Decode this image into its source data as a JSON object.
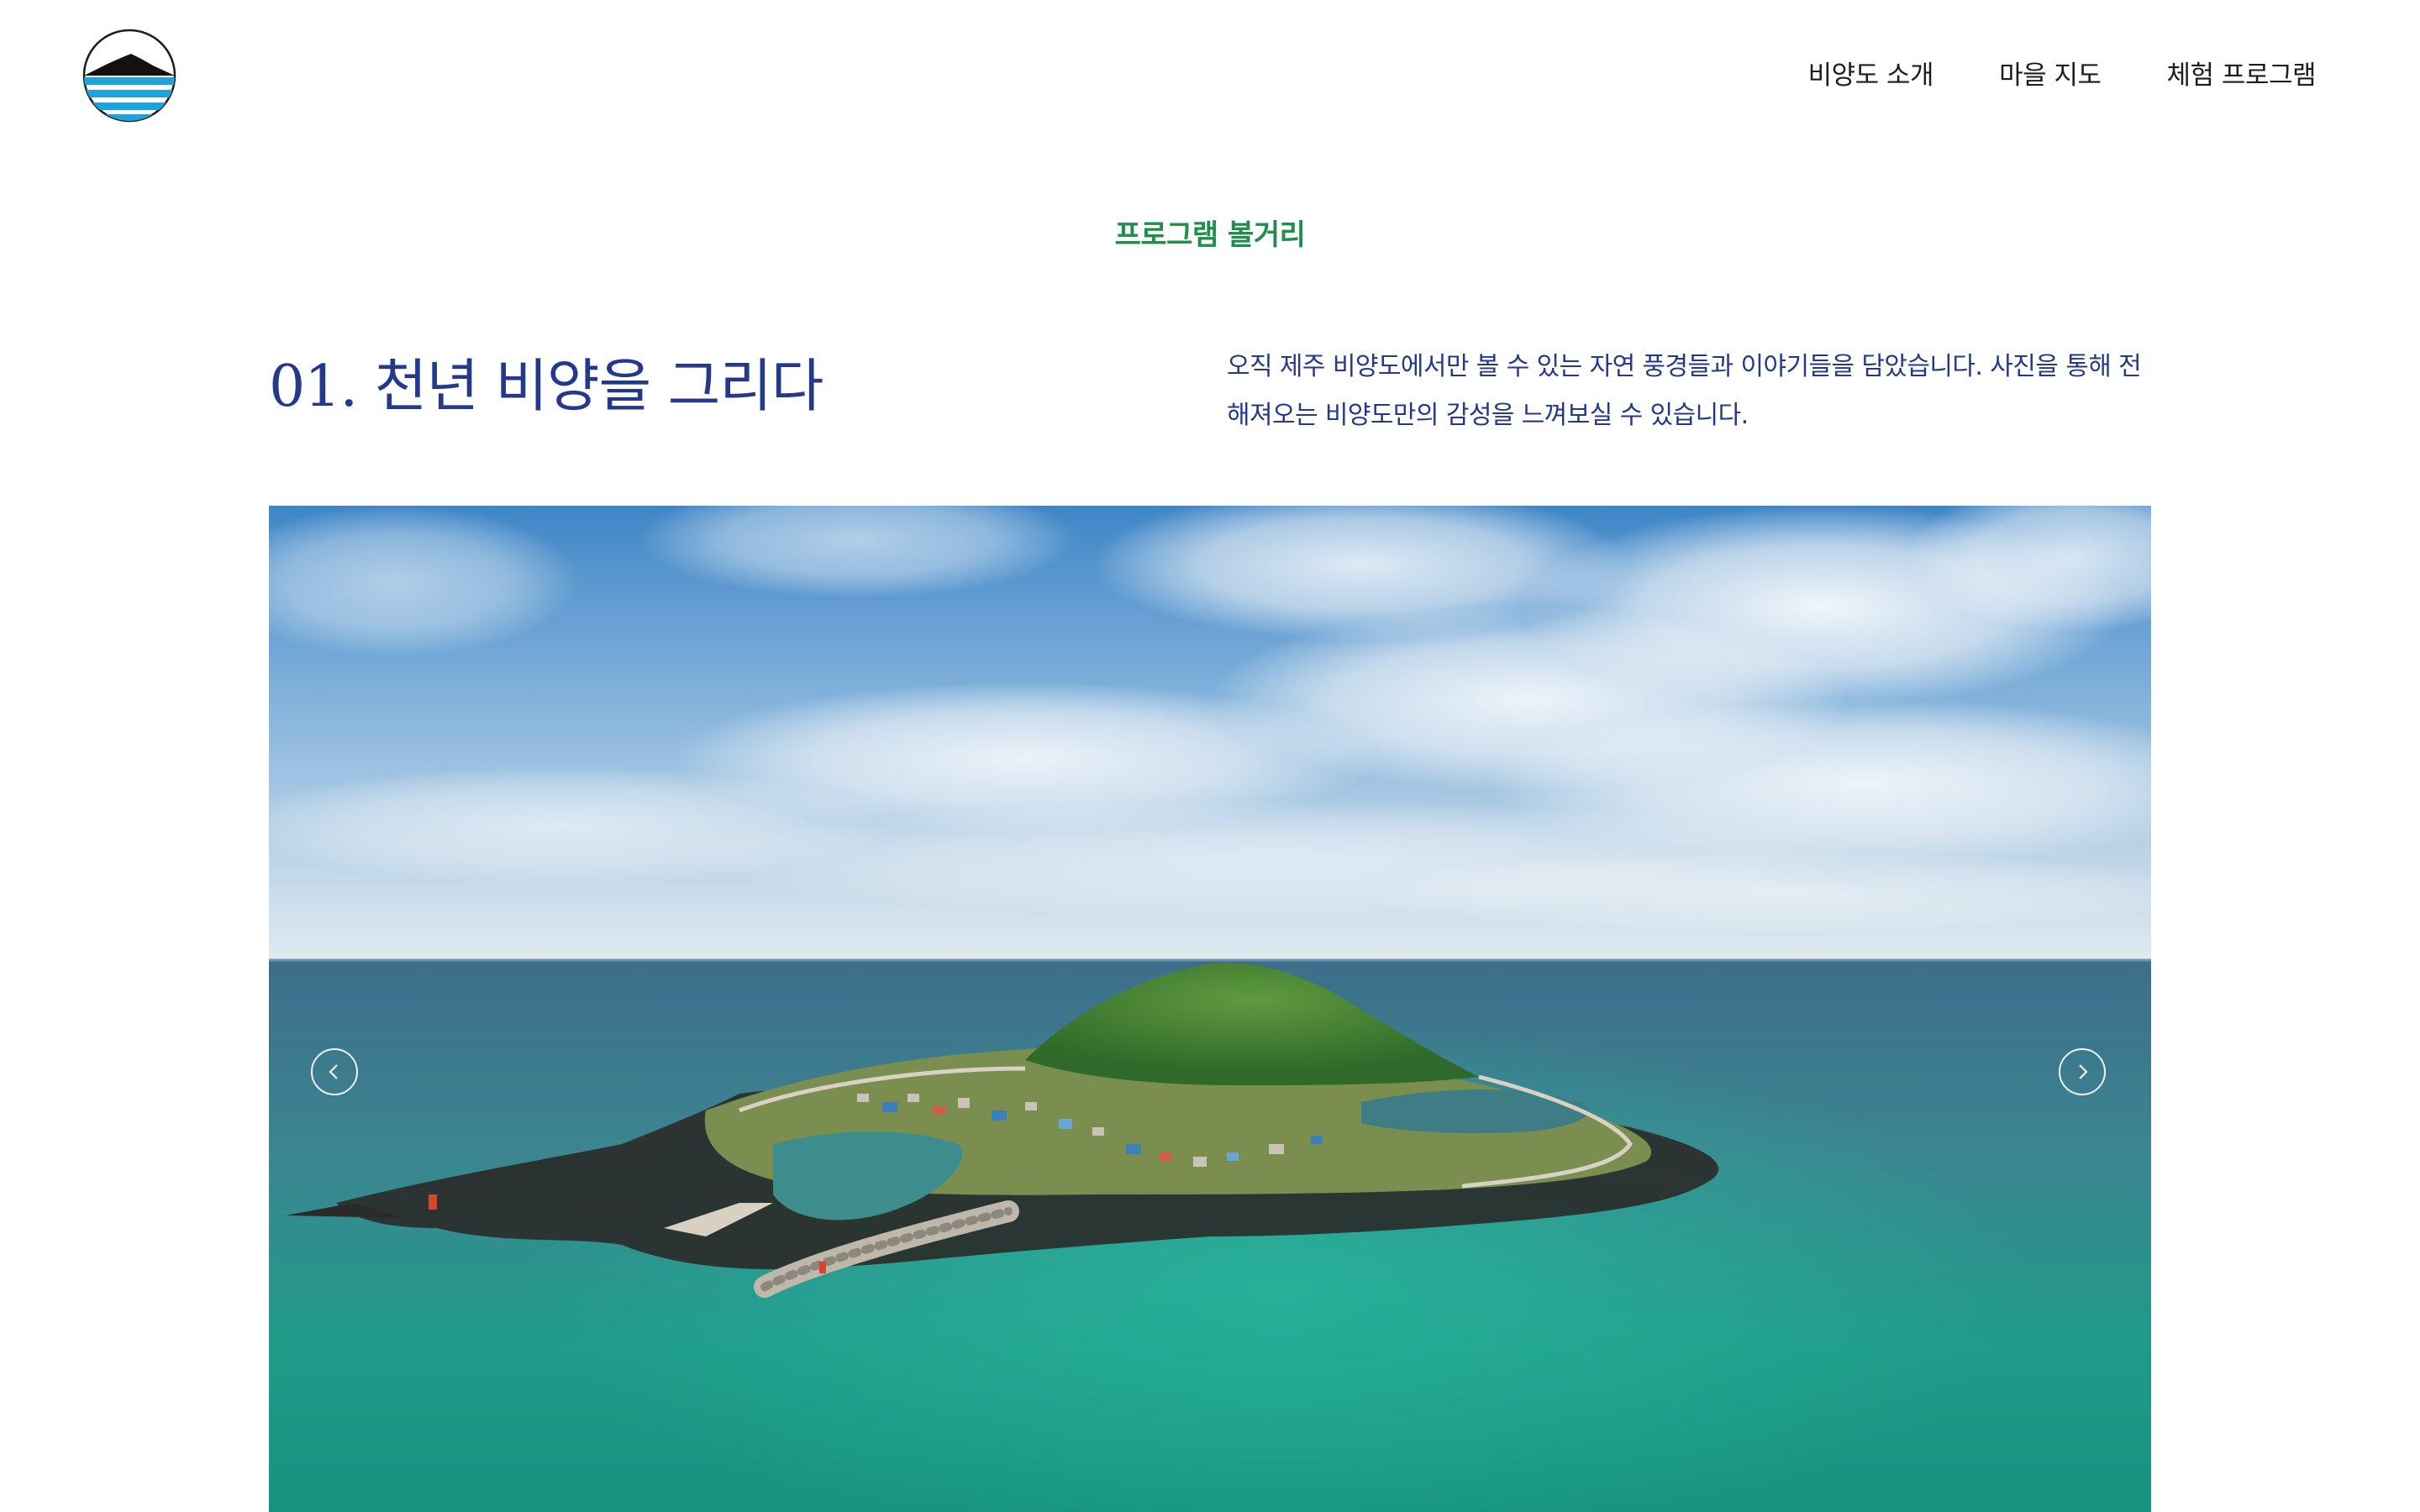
{
  "header": {
    "logo_icon": "island-sun-waves-logo",
    "nav": [
      {
        "label": "비양도 소개"
      },
      {
        "label": "마을 지도"
      },
      {
        "label": "체험 프로그램"
      }
    ]
  },
  "section": {
    "eyebrow": "프로그램 볼거리",
    "title": "01. 천년 비양을 그리다",
    "description": "오직 제주 비양도에서만 볼 수 있는 자연 풍경들과 이야기들을 담았습니다. 사진을 통해 전해져오는 비양도만의 감성을 느껴보실 수 있습니다."
  },
  "carousel": {
    "prev_icon": "chevron-left-icon",
    "next_icon": "chevron-right-icon",
    "image": "aerial-island-photo"
  },
  "colors": {
    "accent_green": "#1e8f4b",
    "title_blue": "#24398c",
    "logo_blue": "#1fa3dc",
    "nav_text": "#1d1d1d"
  }
}
